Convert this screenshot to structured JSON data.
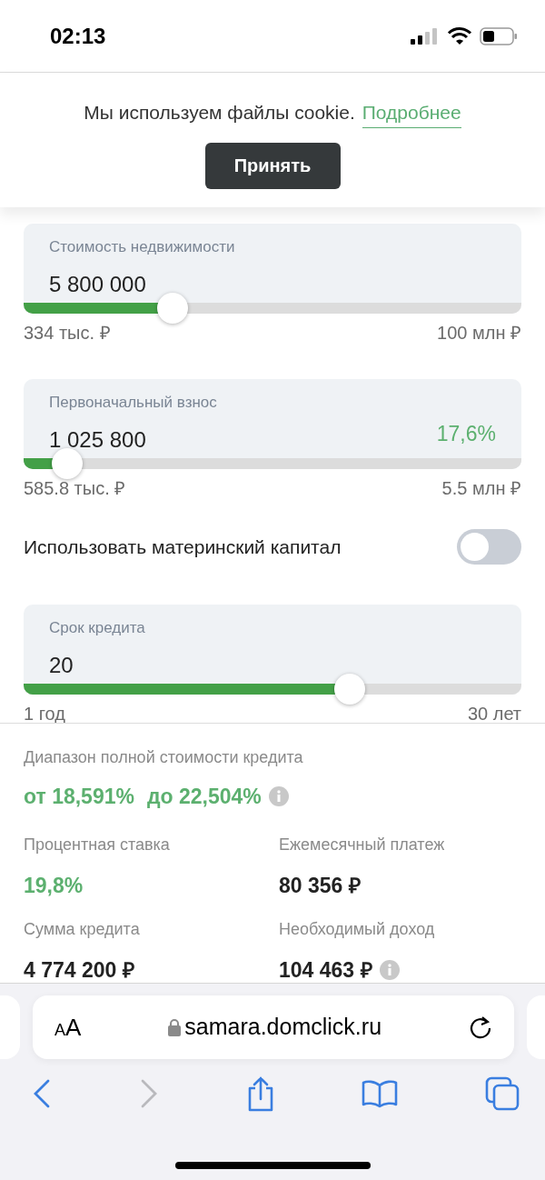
{
  "status_bar": {
    "time": "02:13"
  },
  "cookie_banner": {
    "message": "Мы используем файлы cookie.",
    "link": "Подробнее",
    "button": "Принять"
  },
  "controls": [
    {
      "kind": "slider",
      "label": "Стоимость недвижимости",
      "value": "5 800 000",
      "level": 0.3,
      "min": "334 тыс. ₽",
      "max": "100 млн ₽"
    },
    {
      "kind": "slider",
      "label": "Первоначальный взнос",
      "value": "1 025 800",
      "percent": "17,6%",
      "level": 0.088,
      "min": "585.8 тыс. ₽",
      "max": "5.5 млн ₽"
    },
    {
      "kind": "toggle",
      "label": "Использовать материнский капитал",
      "on": false
    },
    {
      "kind": "slider",
      "label": "Срок кредита",
      "value": "20",
      "level": 0.655,
      "min": "1 год",
      "max": "30 лет"
    }
  ],
  "results": {
    "range_label": "Диапазон полной стоимости кредита",
    "range_from": "от 18,591%",
    "range_to": "до 22,504%",
    "stats": [
      {
        "label": "Процентная ставка",
        "value": "19,8%",
        "highlighted": true,
        "info": false
      },
      {
        "label": "Ежемесячный платеж",
        "value": "80 356 ₽",
        "highlighted": false,
        "info": false
      },
      {
        "label": "Сумма кредита",
        "value": "4 774 200 ₽",
        "highlighted": false,
        "info": false
      },
      {
        "label": "Необходимый доход",
        "value": "104 463 ₽",
        "highlighted": false,
        "info": true
      }
    ]
  },
  "browser": {
    "text_size_button": "AA",
    "url": "samara.domclick.ru",
    "toolbar": [
      {
        "kind": "back",
        "disabled": false
      },
      {
        "kind": "forward",
        "disabled": true
      },
      {
        "kind": "share",
        "disabled": false
      },
      {
        "kind": "bookmarks",
        "disabled": false
      },
      {
        "kind": "tabs",
        "disabled": false
      }
    ]
  }
}
